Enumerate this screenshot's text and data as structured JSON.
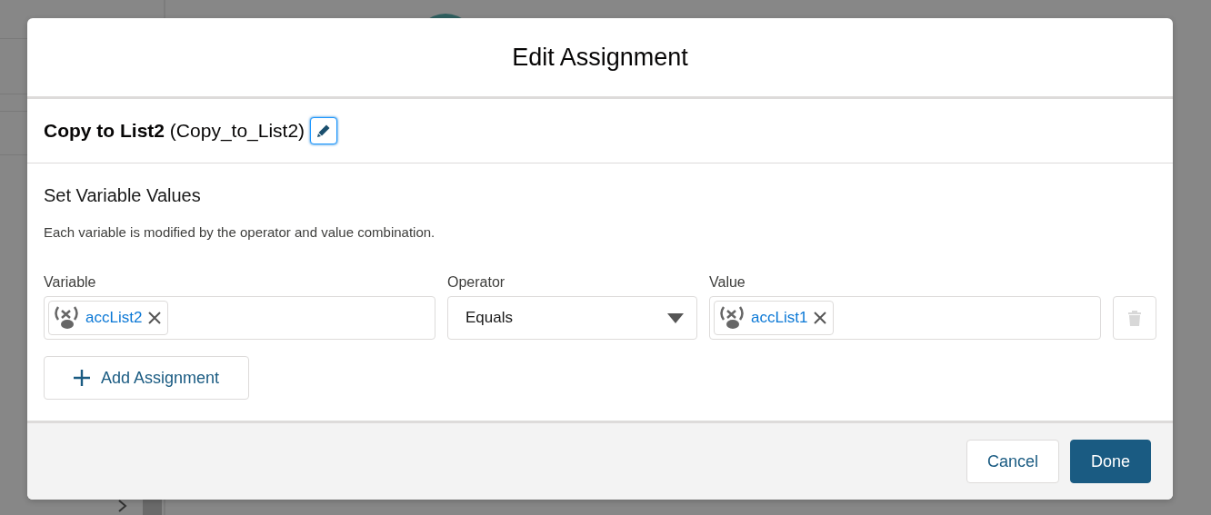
{
  "modal": {
    "title": "Edit Assignment"
  },
  "element": {
    "label": "Copy to List2",
    "api_name": "(Copy_to_List2)",
    "edit_focused": true
  },
  "section": {
    "title": "Set Variable Values",
    "description": "Each variable is modified by the operator and value combination."
  },
  "columns": [
    "Variable",
    "Operator",
    "Value"
  ],
  "assignments": [
    {
      "variable": "accList2",
      "operator": "Equals",
      "value": "accList1",
      "delete_disabled": true
    }
  ],
  "add_button": "Add Assignment",
  "footer_buttons": [
    {
      "label": "Cancel",
      "kind": "neutral"
    },
    {
      "label": "Done",
      "kind": "brand"
    }
  ]
}
